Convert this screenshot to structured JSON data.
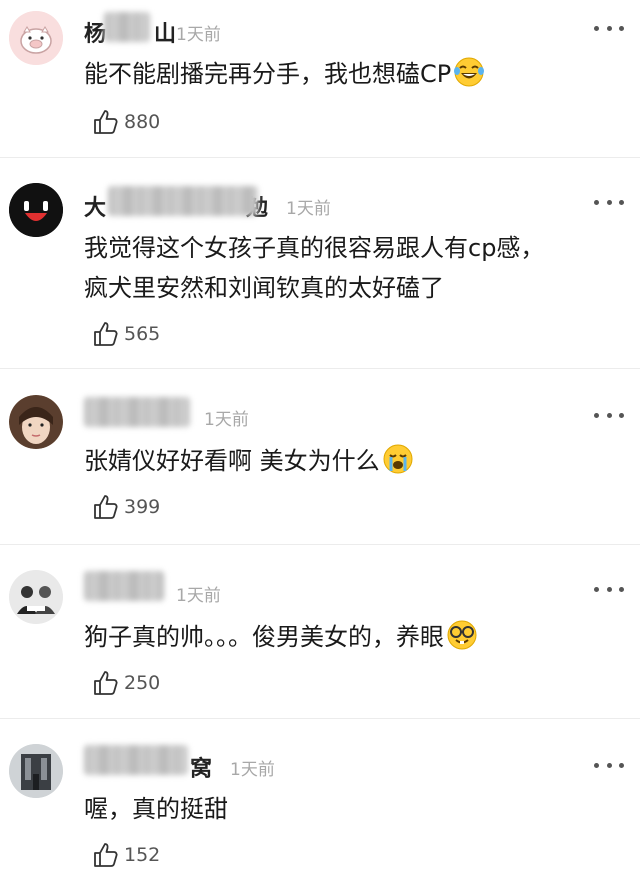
{
  "comments": [
    {
      "username_prefix": "杨",
      "username_suffix": "山",
      "time": "1天前",
      "lines": [
        "能不能剧播完再分手，我也想磕CP"
      ],
      "emoji": "laughing-tears-emoji",
      "likes": "880"
    },
    {
      "username_prefix": "大",
      "username_suffix": "勉",
      "time": "1天前",
      "lines": [
        "我觉得这个女孩子真的很容易跟人有cp感，",
        "疯犬里安然和刘闻钦真的太好磕了"
      ],
      "emoji": "",
      "likes": "565"
    },
    {
      "username_prefix": "",
      "username_suffix": "",
      "time": "1天前",
      "lines": [
        "张婧仪好好看啊 美女为什么"
      ],
      "emoji": "crying-emoji",
      "likes": "399"
    },
    {
      "username_prefix": "",
      "username_suffix": "",
      "time": "1天前",
      "lines": [
        "狗子真的帅。。。俊男美女的，养眼"
      ],
      "emoji": "nerd-glasses-emoji",
      "likes": "250"
    },
    {
      "username_prefix": "",
      "username_suffix": "窝",
      "time": "1天前",
      "lines": [
        "喔，真的挺甜"
      ],
      "emoji": "",
      "likes": "152"
    }
  ],
  "icons": {
    "more": "more-dots-icon",
    "like": "thumbs-up-icon"
  },
  "colors": {
    "time": "#a8a8a8",
    "text": "#1a1a1a",
    "divider": "#ececec"
  }
}
